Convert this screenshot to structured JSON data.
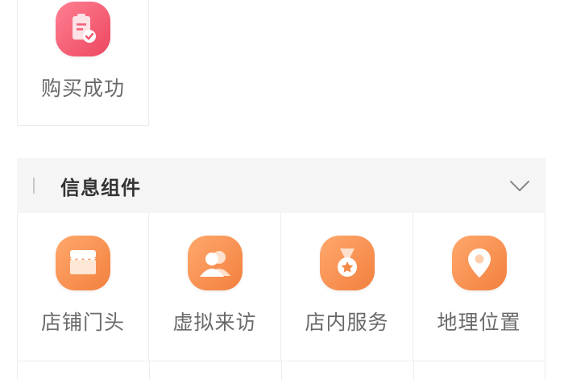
{
  "previous_section": {
    "items": [
      {
        "label": "购买成功",
        "icon": "clipboard-check-icon",
        "color": "#f25a6e"
      }
    ]
  },
  "info_section": {
    "title": "信息组件",
    "expanded": true,
    "items": [
      {
        "label": "店铺门头",
        "icon": "storefront-icon",
        "color": "#f48a47"
      },
      {
        "label": "虚拟来访",
        "icon": "visitors-icon",
        "color": "#f48a47"
      },
      {
        "label": "店内服务",
        "icon": "medal-icon",
        "color": "#f48a47"
      },
      {
        "label": "地理位置",
        "icon": "location-pin-icon",
        "color": "#f48a47"
      }
    ]
  }
}
